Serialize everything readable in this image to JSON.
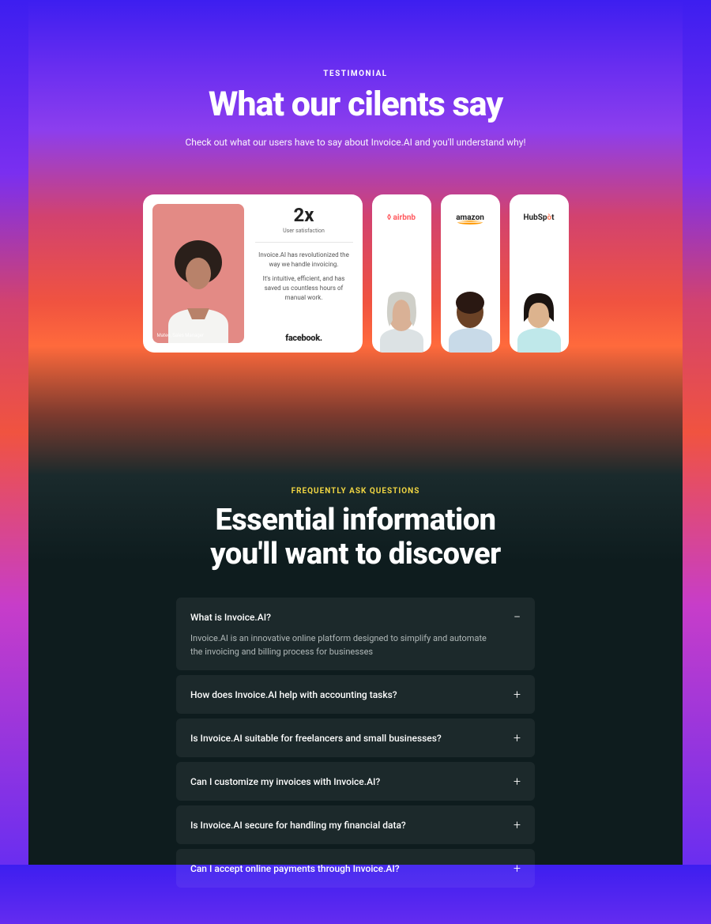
{
  "testimonial": {
    "eyebrow": "TESTIMONIAL",
    "title": "What our cilents say",
    "subtitle": "Check out what our users have to say about Invoice.AI and you'll understand why!",
    "main_card": {
      "stat": "2x",
      "stat_label": "User satisfaction",
      "p1": "Invoice.AI has revolutionized the way we handle invoicing.",
      "p2": "It's intuitive, efficient, and has saved us countless hours of manual work.",
      "brand": "facebook.",
      "person_tag": "Mateo, Sales Manager"
    },
    "small_cards": [
      {
        "brand": "airbnb"
      },
      {
        "brand": "amazon"
      },
      {
        "brand": "HubSpot"
      }
    ]
  },
  "faq": {
    "eyebrow": "FREQUENTLY ASK QUESTIONS",
    "title_l1": "Essential information",
    "title_l2": "you'll want to discover",
    "items": [
      {
        "q": "What is Invoice.AI?",
        "a": "Invoice.AI is an innovative online platform designed to simplify and automate the invoicing and billing process for businesses",
        "open": true
      },
      {
        "q": "How does Invoice.AI help with accounting tasks?",
        "open": false
      },
      {
        "q": "Is Invoice.AI suitable for freelancers and small businesses?",
        "open": false
      },
      {
        "q": "Can I customize my invoices with Invoice.AI?",
        "open": false
      },
      {
        "q": "Is Invoice.AI secure for handling my financial data?",
        "open": false
      },
      {
        "q": "Can I accept online payments through Invoice.AI?",
        "open": false
      }
    ]
  }
}
